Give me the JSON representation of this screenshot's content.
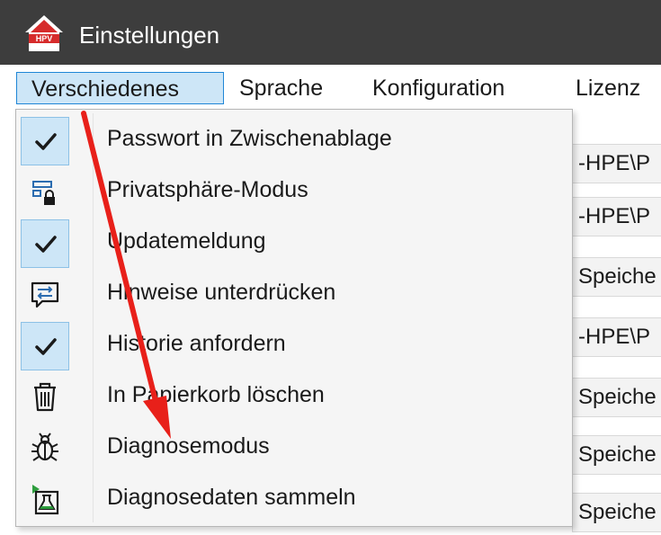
{
  "window": {
    "title": "Einstellungen",
    "logo_text": "HPV"
  },
  "menubar": {
    "items": [
      {
        "label": "Verschiedenes",
        "active": true
      },
      {
        "label": "Sprache"
      },
      {
        "label": "Konfiguration"
      },
      {
        "label": "Lizenz"
      }
    ]
  },
  "background_fields": [
    "-HPE\\P",
    "-HPE\\P",
    "Speiche",
    "-HPE\\P",
    "Speiche",
    "Speiche",
    "Speiche"
  ],
  "dropdown": {
    "items": [
      {
        "label": "Passwort in Zwischenablage",
        "icon": "checkmark-icon",
        "checked": true
      },
      {
        "label": "Privatsphäre-Modus",
        "icon": "privacy-lock-icon",
        "checked": false
      },
      {
        "label": "Updatemeldung",
        "icon": "checkmark-icon",
        "checked": true
      },
      {
        "label": "Hinweise unterdrücken",
        "icon": "message-swap-icon",
        "checked": false
      },
      {
        "label": "Historie anfordern",
        "icon": "checkmark-icon",
        "checked": true
      },
      {
        "label": "In Papierkorb löschen",
        "icon": "trash-icon",
        "checked": false
      },
      {
        "label": "Diagnosemodus",
        "icon": "bug-icon",
        "checked": false
      },
      {
        "label": "Diagnosedaten sammeln",
        "icon": "flask-play-icon",
        "checked": false
      }
    ]
  },
  "colors": {
    "titlebar": "#3d3d3d",
    "menu_active_bg": "#cde6f7",
    "menu_active_border": "#1f86d6",
    "annotation_arrow": "#e8201a"
  }
}
